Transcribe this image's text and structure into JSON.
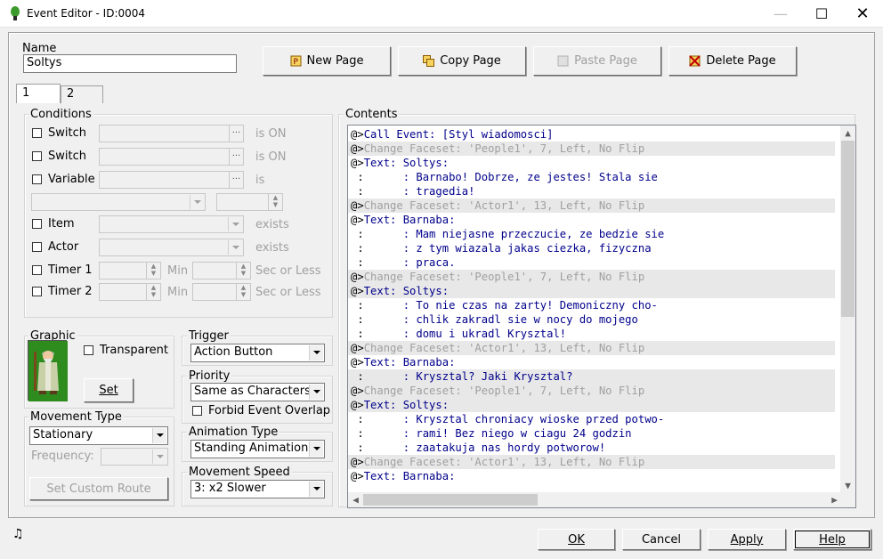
{
  "window": {
    "title": "Event Editor - ID:0004",
    "minimize": "—",
    "maximize": "☐",
    "close": "✕"
  },
  "name": {
    "label": "Name",
    "value": "Soltys"
  },
  "page_buttons": {
    "new": "New Page",
    "copy": "Copy Page",
    "paste": "Paste Page",
    "delete": "Delete Page"
  },
  "tabs": [
    "1",
    "2"
  ],
  "conditions": {
    "title": "Conditions",
    "switch1": {
      "label": "Switch",
      "suffix": "is ON"
    },
    "switch2": {
      "label": "Switch",
      "suffix": "is ON"
    },
    "variable": {
      "label": "Variable",
      "suffix": "is"
    },
    "item": {
      "label": "Item",
      "suffix": "exists"
    },
    "actor": {
      "label": "Actor",
      "suffix": "exists"
    },
    "timer1": {
      "label": "Timer 1",
      "min": "Min",
      "suffix": "Sec or Less"
    },
    "timer2": {
      "label": "Timer 2",
      "min": "Min",
      "suffix": "Sec or Less"
    }
  },
  "graphic": {
    "title": "Graphic",
    "transparent": "Transparent",
    "set": "Set",
    "sprite_icon": "elder-wizard-sprite"
  },
  "trigger": {
    "title": "Trigger",
    "value": "Action Button"
  },
  "priority": {
    "title": "Priority",
    "value": "Same as Characters",
    "forbid": "Forbid Event Overlap"
  },
  "movement_type": {
    "title": "Movement Type",
    "value": "Stationary",
    "frequency": "Frequency:",
    "custom_route": "Set Custom Route"
  },
  "animation_type": {
    "title": "Animation Type",
    "value": "Standing Animation"
  },
  "movement_speed": {
    "title": "Movement Speed",
    "value": "3: x2 Slower"
  },
  "contents": {
    "title": "Contents",
    "lines": [
      {
        "prefix": "@>",
        "text": "Call Event: [Styl wiadomosci]",
        "color": "blue",
        "hl": false
      },
      {
        "prefix": "@>",
        "text": "Change Faceset: 'People1', 7, Left, No Flip",
        "color": "gray",
        "hl": true
      },
      {
        "prefix": "@>",
        "text": "Text: Soltys:",
        "color": "blue",
        "hl": false
      },
      {
        "prefix": " :",
        "text": "      : Barnabo! Dobrze, ze jestes! Stala sie",
        "color": "blue",
        "hl": false
      },
      {
        "prefix": " :",
        "text": "      : tragedia!",
        "color": "blue",
        "hl": false
      },
      {
        "prefix": "@>",
        "text": "Change Faceset: 'Actor1', 13, Left, No Flip",
        "color": "gray",
        "hl": true
      },
      {
        "prefix": "@>",
        "text": "Text: Barnaba:",
        "color": "blue",
        "hl": false
      },
      {
        "prefix": " :",
        "text": "      : Mam niejasne przeczucie, ze bedzie sie",
        "color": "blue",
        "hl": false
      },
      {
        "prefix": " :",
        "text": "      : z tym wiazala jakas ciezka, fizyczna",
        "color": "blue",
        "hl": false
      },
      {
        "prefix": " :",
        "text": "      : praca.",
        "color": "blue",
        "hl": false
      },
      {
        "prefix": "@>",
        "text": "Change Faceset: 'People1', 7, Left, No Flip",
        "color": "gray",
        "hl": true
      },
      {
        "prefix": "@>",
        "text": "Text: Soltys:",
        "color": "blue",
        "hl": true
      },
      {
        "prefix": " :",
        "text": "      : To nie czas na zarty! Demoniczny cho-",
        "color": "blue",
        "hl": false
      },
      {
        "prefix": " :",
        "text": "      : chlik zakradl sie w nocy do mojego",
        "color": "blue",
        "hl": false
      },
      {
        "prefix": " :",
        "text": "      : domu i ukradl Krysztal!",
        "color": "blue",
        "hl": false
      },
      {
        "prefix": "@>",
        "text": "Change Faceset: 'Actor1', 13, Left, No Flip",
        "color": "gray",
        "hl": true
      },
      {
        "prefix": "@>",
        "text": "Text: Barnaba:",
        "color": "blue",
        "hl": false
      },
      {
        "prefix": " :",
        "text": "      : Krysztal? Jaki Krysztal?",
        "color": "blue",
        "hl": true
      },
      {
        "prefix": "@>",
        "text": "Change Faceset: 'People1', 7, Left, No Flip",
        "color": "gray",
        "hl": true
      },
      {
        "prefix": "@>",
        "text": "Text: Soltys:",
        "color": "blue",
        "hl": true
      },
      {
        "prefix": " :",
        "text": "      : Krysztal chroniacy wioske przed potwo-",
        "color": "blue",
        "hl": false
      },
      {
        "prefix": " :",
        "text": "      : rami! Bez niego w ciagu 24 godzin",
        "color": "blue",
        "hl": false
      },
      {
        "prefix": " :",
        "text": "      : zaatakuja nas hordy potworow!",
        "color": "blue",
        "hl": false
      },
      {
        "prefix": "@>",
        "text": "Change Faceset: 'Actor1', 13, Left, No Flip",
        "color": "gray",
        "hl": true
      },
      {
        "prefix": "@>",
        "text": "Text: Barnaba:",
        "color": "blue",
        "hl": false
      }
    ]
  },
  "footer": {
    "ok": "OK",
    "cancel": "Cancel",
    "apply": "Apply",
    "help": "Help",
    "music_icon": "music-note-icon"
  }
}
